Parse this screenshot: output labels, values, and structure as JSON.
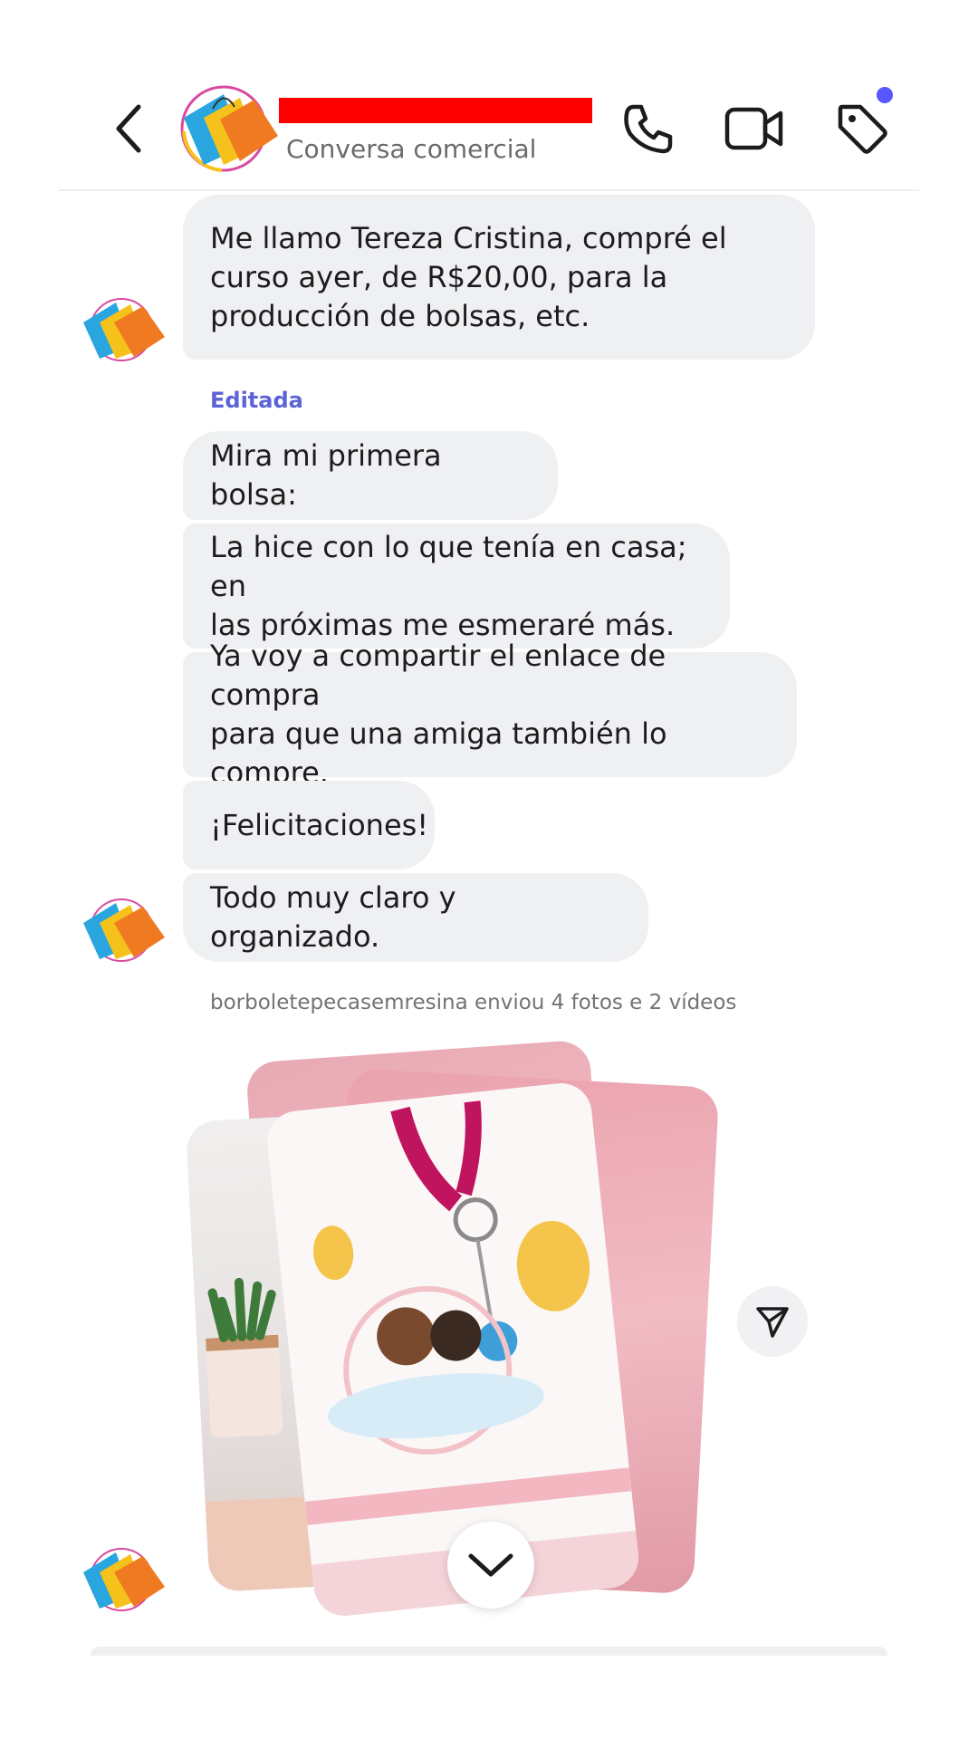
{
  "header": {
    "subtitle": "Conversa comercial",
    "notification_color": "#5856ff"
  },
  "icons": {
    "back": "chevron-left-icon",
    "call": "phone-icon",
    "video": "video-camera-icon",
    "tag": "tag-icon",
    "send": "paper-plane-icon",
    "scroll_down": "chevron-down-icon"
  },
  "messages": [
    {
      "text": "Me llamo Tereza Cristina, compré el\ncurso ayer, de R$20,00, para la\nproducción de bolsas, etc."
    },
    {
      "text": "Mira mi primera bolsa:"
    },
    {
      "text": "La hice con lo que tenía en casa; en\nlas próximas me esmeraré más."
    },
    {
      "text": "Ya voy a compartir el enlace de compra\npara que una amiga también lo compre."
    },
    {
      "text": "¡Felicitaciones!"
    },
    {
      "text": "Todo muy claro y organizado."
    }
  ],
  "edited_label": "Editada",
  "media": {
    "caption": "borboletepecasemresina enviou 4 fotos e 2 vídeos"
  },
  "colors": {
    "bubble": "#eff0f2",
    "edited": "#5b63d6",
    "redaction": "#ff0000"
  }
}
